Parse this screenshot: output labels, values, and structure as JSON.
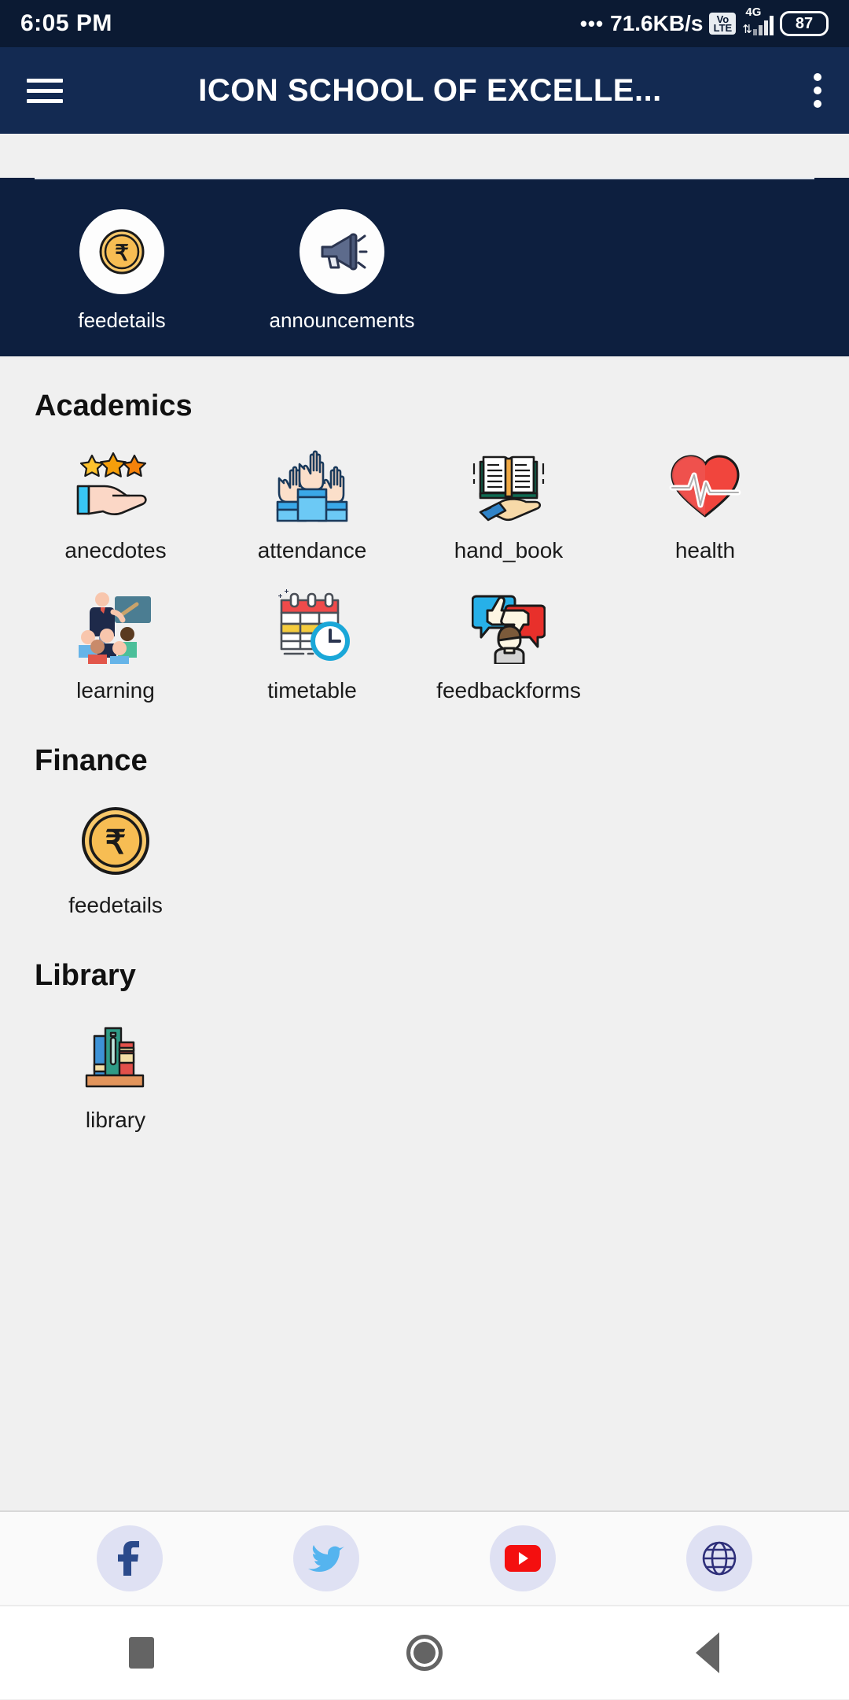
{
  "status_bar": {
    "time": "6:05 PM",
    "overflow_dots": "•••",
    "network_speed": "71.6KB/s",
    "volte_top": "Vo",
    "volte_bottom": "LTE",
    "network_type": "4G",
    "data_arrows": "⇅",
    "battery": "87"
  },
  "app_bar": {
    "menu_icon": "hamburger-menu-icon",
    "title": "ICON SCHOOL OF EXCELLE...",
    "overflow_icon": "kebab-menu-icon"
  },
  "hero": {
    "shortcuts": [
      {
        "label": "feedetails",
        "icon": "rupee-coin-icon"
      },
      {
        "label": "announcements",
        "icon": "megaphone-icon"
      }
    ]
  },
  "sections": [
    {
      "title": "Academics",
      "items": [
        {
          "label": "anecdotes",
          "icon": "stars-hand-icon"
        },
        {
          "label": "attendance",
          "icon": "raised-hands-icon"
        },
        {
          "label": "hand_book",
          "icon": "open-book-hand-icon"
        },
        {
          "label": "health",
          "icon": "heart-pulse-icon"
        },
        {
          "label": "learning",
          "icon": "teacher-classroom-icon"
        },
        {
          "label": "timetable",
          "icon": "calendar-clock-icon"
        },
        {
          "label": "feedbackforms",
          "icon": "thumbs-feedback-icon"
        }
      ]
    },
    {
      "title": "Finance",
      "items": [
        {
          "label": "feedetails",
          "icon": "rupee-coin-icon"
        }
      ]
    },
    {
      "title": "Library",
      "items": [
        {
          "label": "library",
          "icon": "bookshelf-icon"
        }
      ]
    }
  ],
  "social_bar": {
    "buttons": [
      {
        "name": "facebook",
        "glyph": "f"
      },
      {
        "name": "twitter",
        "glyph": ""
      },
      {
        "name": "youtube",
        "glyph": ""
      },
      {
        "name": "website",
        "glyph": ""
      }
    ]
  },
  "nav_bar": {
    "recents": "recents-square-icon",
    "home": "home-circle-icon",
    "back": "back-triangle-icon"
  },
  "colors": {
    "status_bar_bg": "#0b1a33",
    "app_bar_bg": "#132a52",
    "hero_bg": "#0d1f3f",
    "content_bg": "#f0f0f0",
    "accent_gold": "#f5b845",
    "accent_red": "#f04a4a",
    "social_bubble": "#dfe1f3"
  }
}
